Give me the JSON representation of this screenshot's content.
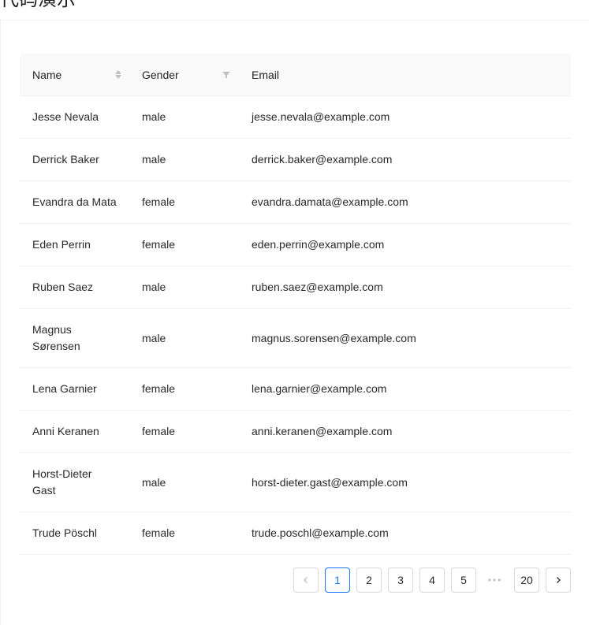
{
  "header": {
    "title": "代码演示"
  },
  "table": {
    "columns": [
      {
        "key": "name",
        "label": "Name"
      },
      {
        "key": "gender",
        "label": "Gender"
      },
      {
        "key": "email",
        "label": "Email"
      }
    ],
    "rows": [
      {
        "name": "Jesse Nevala",
        "gender": "male",
        "email": "jesse.nevala@example.com"
      },
      {
        "name": "Derrick Baker",
        "gender": "male",
        "email": "derrick.baker@example.com"
      },
      {
        "name": "Evandra da Mata",
        "gender": "female",
        "email": "evandra.damata@example.com"
      },
      {
        "name": "Eden Perrin",
        "gender": "female",
        "email": "eden.perrin@example.com"
      },
      {
        "name": "Ruben Saez",
        "gender": "male",
        "email": "ruben.saez@example.com"
      },
      {
        "name": "Magnus Sørensen",
        "gender": "male",
        "email": "magnus.sorensen@example.com"
      },
      {
        "name": "Lena Garnier",
        "gender": "female",
        "email": "lena.garnier@example.com"
      },
      {
        "name": "Anni Keranen",
        "gender": "female",
        "email": "anni.keranen@example.com"
      },
      {
        "name": "Horst-Dieter Gast",
        "gender": "male",
        "email": "horst-dieter.gast@example.com"
      },
      {
        "name": "Trude Pöschl",
        "gender": "female",
        "email": "trude.poschl@example.com"
      }
    ]
  },
  "pagination": {
    "pages": [
      "1",
      "2",
      "3",
      "4",
      "5"
    ],
    "current": "1",
    "ellipsis": "•••",
    "last": "20"
  },
  "colors": {
    "accent": "#1677ff",
    "border": "#f0f0f0",
    "header_bg": "#fafafa"
  }
}
